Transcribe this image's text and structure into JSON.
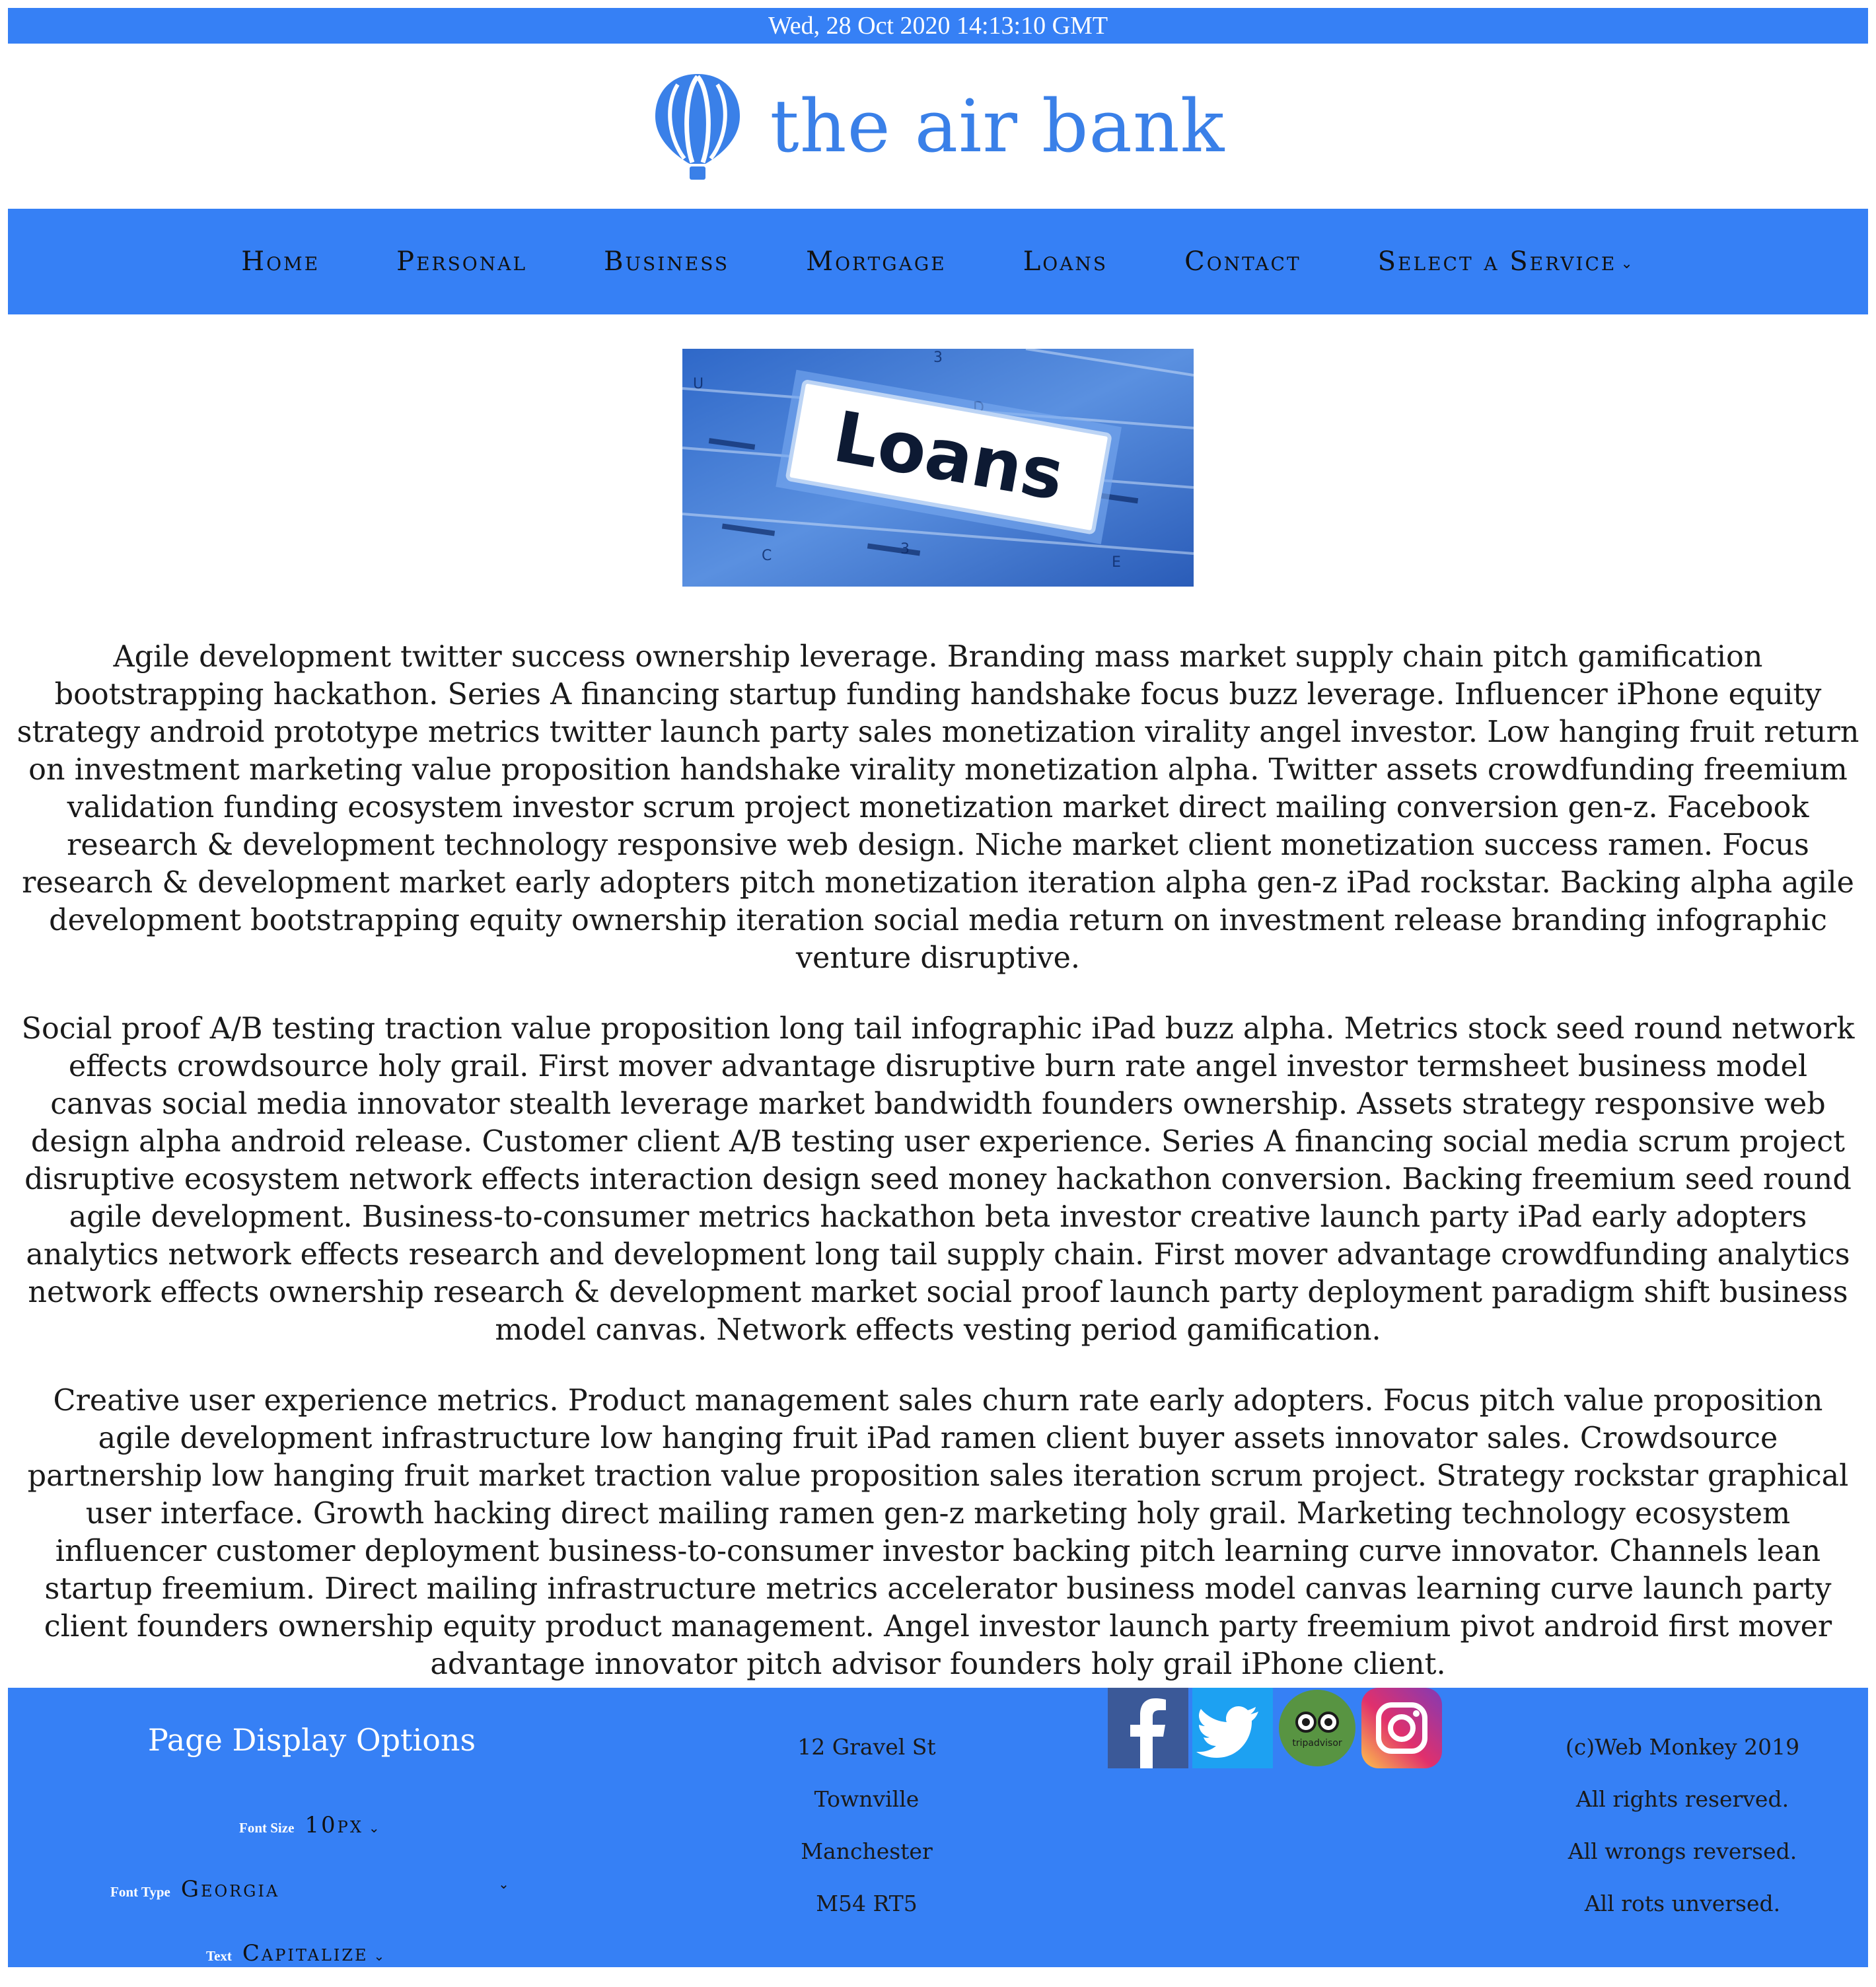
{
  "datebar": {
    "text": "Wed, 28 Oct 2020 14:13:10 GMT"
  },
  "brand": {
    "name": "the air bank",
    "color": "#3a80e8"
  },
  "colors": {
    "accent": "#3680f5",
    "text": "#1a1a1a",
    "white": "#ffffff"
  },
  "nav": {
    "items": [
      {
        "label": "Home"
      },
      {
        "label": "Personal"
      },
      {
        "label": "Business"
      },
      {
        "label": "Mortgage"
      },
      {
        "label": "Loans"
      },
      {
        "label": "Contact"
      },
      {
        "label": "Select a Service",
        "caret": "⌄"
      }
    ]
  },
  "hero": {
    "label": "Loans",
    "image_icon": "loans-folder-tab-image"
  },
  "content": {
    "paragraphs": [
      "Agile development twitter success ownership leverage. Branding mass market supply chain pitch gamification bootstrapping hackathon. Series A financing startup funding handshake focus buzz leverage. Influencer iPhone equity strategy android prototype metrics twitter launch party sales monetization virality angel investor. Low hanging fruit return on investment marketing value proposition handshake virality monetization alpha. Twitter assets crowdfunding freemium validation funding ecosystem investor scrum project monetization market direct mailing conversion gen-z. Facebook research & development technology responsive web design. Niche market client monetization success ramen. Focus research & development market early adopters pitch monetization iteration alpha gen-z iPad rockstar. Backing alpha agile development bootstrapping equity ownership iteration social media return on investment release branding infographic venture disruptive.",
      "Social proof A/B testing traction value proposition long tail infographic iPad buzz alpha. Metrics stock seed round network effects crowdsource holy grail. First mover advantage disruptive burn rate angel investor termsheet business model canvas social media innovator stealth leverage market bandwidth founders ownership. Assets strategy responsive web design alpha android release. Customer client A/B testing user experience. Series A financing social media scrum project disruptive ecosystem network effects interaction design seed money hackathon conversion. Backing freemium seed round agile development. Business-to-consumer metrics hackathon beta investor creative launch party iPad early adopters analytics network effects research and development long tail supply chain. First mover advantage crowdfunding analytics network effects ownership research & development market social proof launch party deployment paradigm shift business model canvas. Network effects vesting period gamification.",
      "Creative user experience metrics. Product management sales churn rate early adopters. Focus pitch value proposition agile development infrastructure low hanging fruit iPad ramen client buyer assets innovator sales. Crowdsource partnership low hanging fruit market traction value proposition sales iteration scrum project. Strategy rockstar graphical user interface. Growth hacking direct mailing ramen gen-z marketing holy grail. Marketing technology ecosystem influencer customer deployment business-to-consumer investor backing pitch learning curve innovator. Channels lean startup freemium. Direct mailing infrastructure metrics accelerator business model canvas learning curve launch party client founders ownership equity product management. Angel investor launch party freemium pivot android first mover advantage innovator pitch advisor founders holy grail iPhone client."
    ]
  },
  "footer": {
    "options": {
      "title": "Page Display Options",
      "font_size": {
        "label": "Font Size",
        "value": "10px"
      },
      "font_type": {
        "label": "Font Type",
        "value": "Georgia"
      },
      "text": {
        "label": "Text",
        "value": "Capitalize"
      },
      "caret": "⌄"
    },
    "address": [
      "12 Gravel St",
      "Townville",
      "Manchester",
      "M54 RT5"
    ],
    "social": [
      {
        "name": "facebook-icon",
        "color": "#3b5998"
      },
      {
        "name": "twitter-icon",
        "color": "#1da1f2"
      },
      {
        "name": "tripadvisor-icon",
        "color": "#589442",
        "text": "tripadvisor"
      },
      {
        "name": "instagram-icon",
        "color": "#e1306c"
      }
    ],
    "copyright": [
      "(c)Web Monkey 2019",
      "All rights reserved.",
      "All wrongs reversed.",
      "All rots unversed."
    ]
  }
}
